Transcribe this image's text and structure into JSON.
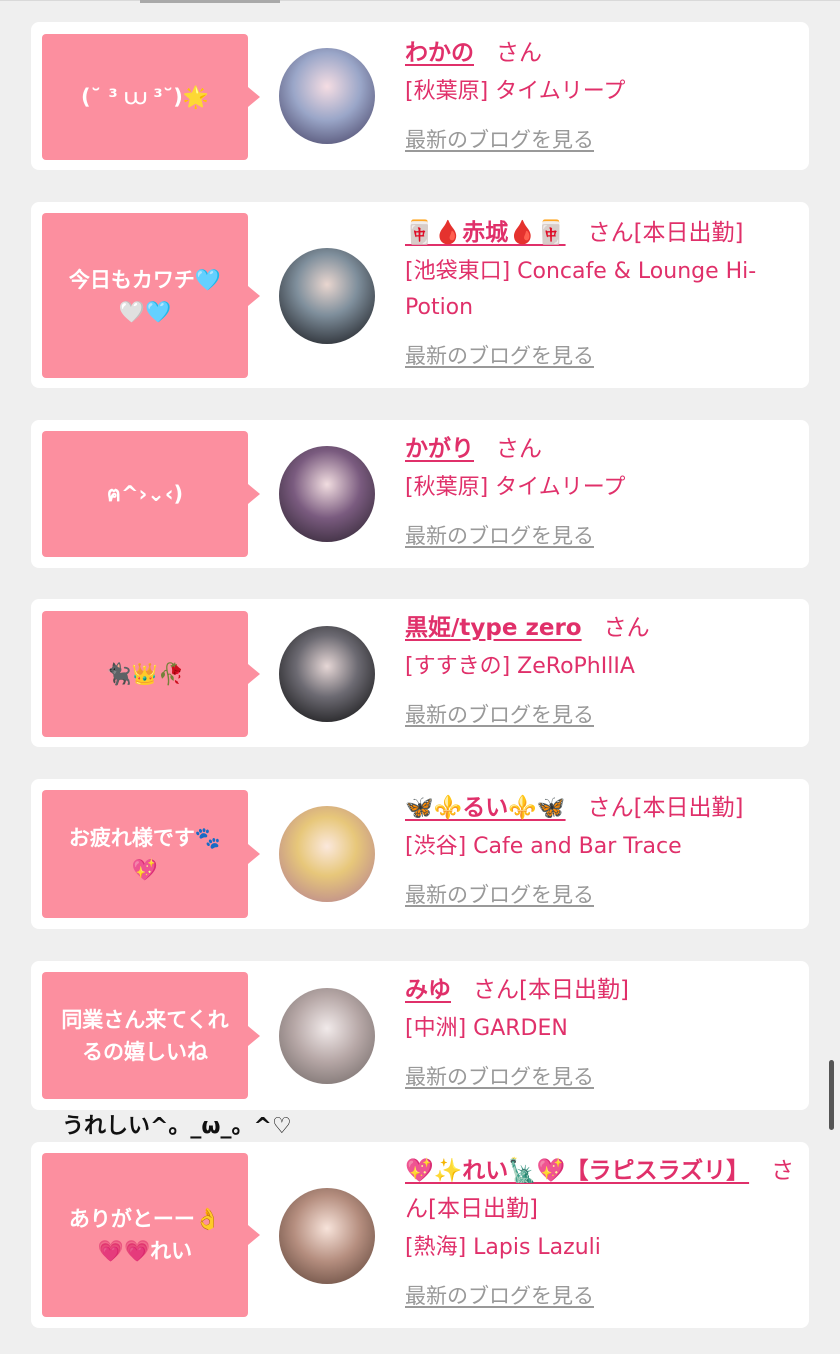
{
  "cards": [
    {
      "bubble_line1": "(˘ ³ ⩊ ³˘)🌟",
      "bubble_line2": "",
      "name": "わかの",
      "san": "さん",
      "shift": "",
      "shop": "[秋葉原] タイムリープ",
      "blog": "最新のブログを見る"
    },
    {
      "bubble_line1": "今日もカワチ🩵",
      "bubble_line2": "🤍🩵",
      "name": "🀄🩸赤城🩸🀄",
      "san": "さん",
      "shift": "[本日出勤]",
      "shop": "[池袋東口] Concafe & Lounge Hi-Potion",
      "blog": "最新のブログを見る"
    },
    {
      "bubble_line1": "ฅ^›⌄‹)",
      "bubble_line2": "",
      "name": "かがり",
      "san": "さん",
      "shift": "",
      "shop": "[秋葉原] タイムリープ",
      "blog": "最新のブログを見る"
    },
    {
      "bubble_line1": "🐈‍⬛👑🥀",
      "bubble_line2": "",
      "name": "黒姫/type zero",
      "san": "さん",
      "shift": "",
      "shop": "[すすきの] ZeRoPhIlIA",
      "blog": "最新のブログを見る"
    },
    {
      "bubble_line1": "お疲れ様です🐾",
      "bubble_line2": "💖",
      "name": "🦋⚜️るい⚜️🦋",
      "san": "さん",
      "shift": "[本日出勤]",
      "shop": "[渋谷] Cafe and Bar Trace",
      "blog": "最新のブログを見る"
    },
    {
      "bubble_line1": "同業さん来てくれ",
      "bubble_line2": "るの嬉しいね",
      "name": "みゆ",
      "san": "さん",
      "shift": "[本日出勤]",
      "shop": "[中洲] GARDEN",
      "blog": "最新のブログを見る"
    },
    {
      "bubble_line1": "ありがとーー👌",
      "bubble_line2": "💗💗れい",
      "name": "💖✨れい🗽💖【ラピスラズリ】",
      "san": "さん",
      "shift": "[本日出勤]",
      "shop": "[熱海] Lapis Lazuli",
      "blog": "最新のブログを見る"
    }
  ],
  "note": "うれしい^。_ω_。^♡",
  "colors": {
    "accent": "#e0306a",
    "bubble": "#fc8f9f",
    "link_gray": "#999999"
  }
}
